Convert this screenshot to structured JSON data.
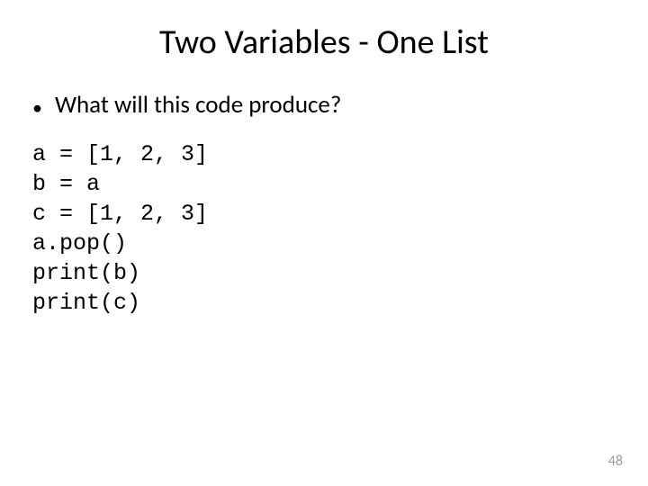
{
  "title": "Two Variables - One List",
  "bullet": "What will this code produce?",
  "code": "a = [1, 2, 3]\nb = a\nc = [1, 2, 3]\na.pop()\nprint(b)\nprint(c)",
  "page_number": "48"
}
